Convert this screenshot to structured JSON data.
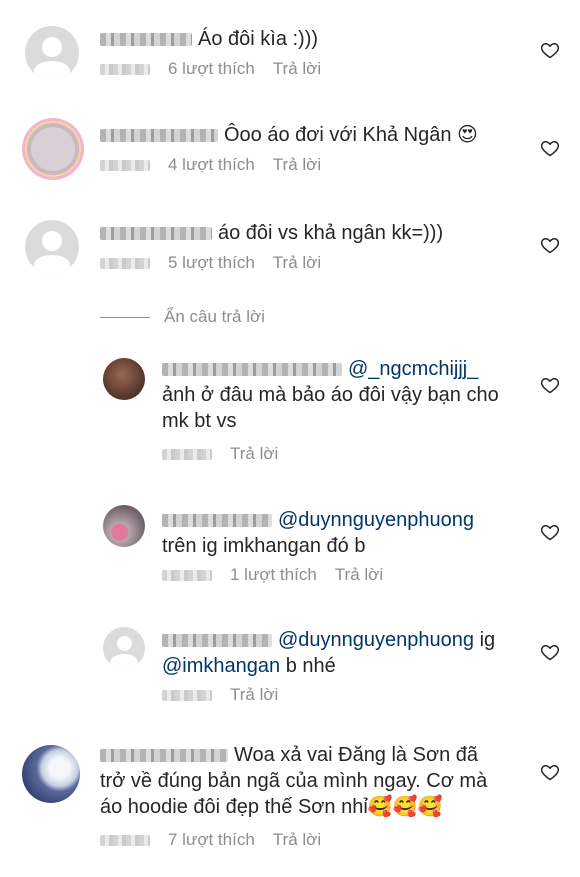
{
  "comments": [
    {
      "text": "Áo đôi kìa :)))",
      "likes": "6 lượt thích",
      "reply": "Trả lời"
    },
    {
      "text": "Ôoo áo đơi với Khả Ngân 😍",
      "likes": "4 lượt thích",
      "reply": "Trả lời"
    },
    {
      "text": "áo đôi vs khả ngân kk=)))",
      "likes": "5 lượt thích",
      "reply": "Trả lời"
    }
  ],
  "hide_replies": "Ẩn câu trả lời",
  "replies": [
    {
      "mention": "@_ngcmchijjj_",
      "line1": "ảnh ở đâu mà bảo áo đôi vậy bạn cho",
      "line2": "mk bt vs",
      "reply": "Trả lời"
    },
    {
      "mention": "@duynnguyenphuong",
      "line1": "trên ig imkhangan đó b",
      "likes": "1 lượt thích",
      "reply": "Trả lời"
    },
    {
      "mention": "@duynnguyenphuong",
      "after": " ig",
      "mention2": "@imkhangan",
      "line2": " b nhé",
      "reply": "Trả lời"
    }
  ],
  "last": {
    "line1": "Woa xả vai Đăng là Sơn đã",
    "line2": "trở về đúng bản ngã của mình ngay. Cơ mà",
    "line3": "áo hoodie đôi đẹp thế Sơn nhỉ🥰🥰🥰",
    "likes": "7 lượt thích",
    "reply": "Trả lời"
  },
  "icons": {
    "like": "heart-outline-icon",
    "avatar": "default-avatar-icon"
  }
}
